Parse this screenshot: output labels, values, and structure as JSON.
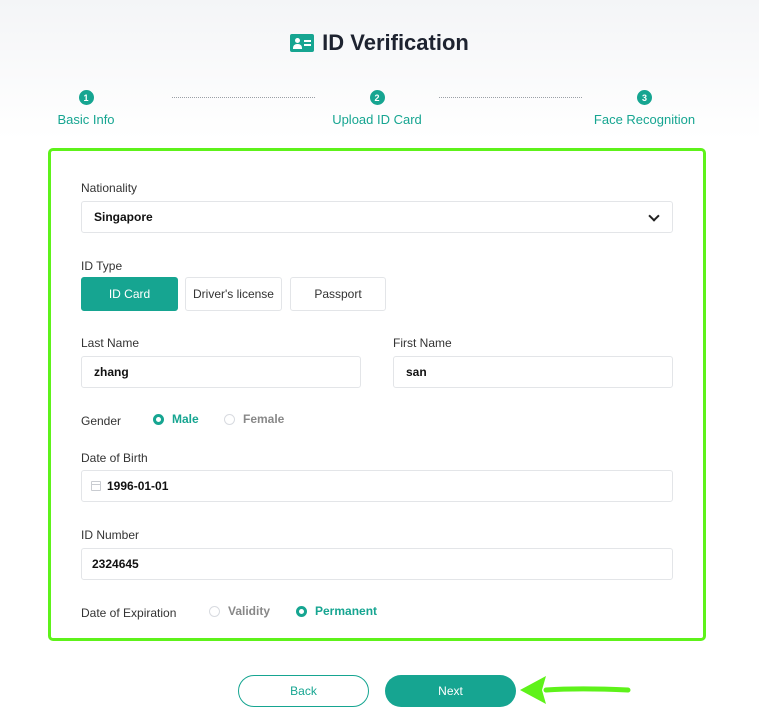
{
  "header": {
    "title": "ID Verification",
    "icon": "id-card-icon"
  },
  "steps": [
    {
      "num": "1",
      "label": "Basic Info"
    },
    {
      "num": "2",
      "label": "Upload ID Card"
    },
    {
      "num": "3",
      "label": "Face Recognition"
    }
  ],
  "form": {
    "nationality": {
      "label": "Nationality",
      "value": "Singapore"
    },
    "id_type": {
      "label": "ID Type",
      "options": [
        "ID Card",
        "Driver's license",
        "Passport"
      ],
      "selected": "ID Card"
    },
    "last_name": {
      "label": "Last Name",
      "value": "zhang"
    },
    "first_name": {
      "label": "First Name",
      "value": "san"
    },
    "gender": {
      "label": "Gender",
      "options": [
        "Male",
        "Female"
      ],
      "selected": "Male"
    },
    "dob": {
      "label": "Date of Birth",
      "value": "1996-01-01"
    },
    "id_number": {
      "label": "ID Number",
      "value": "2324645"
    },
    "expiration": {
      "label": "Date of Expiration",
      "options": [
        "Validity",
        "Permanent"
      ],
      "selected": "Permanent"
    }
  },
  "buttons": {
    "back": "Back",
    "next": "Next"
  },
  "colors": {
    "accent": "#16a591",
    "highlight": "#5ef21a"
  }
}
